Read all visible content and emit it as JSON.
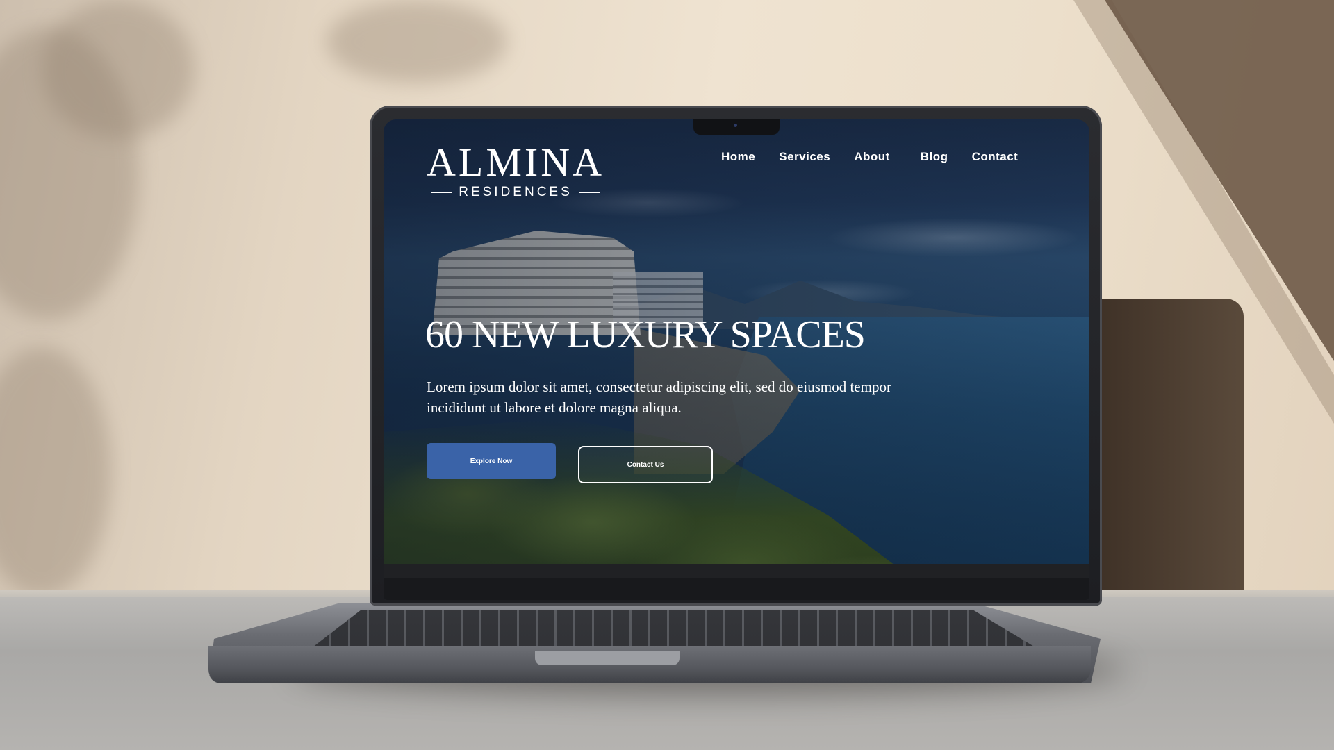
{
  "site": {
    "logo_main": "ALMINA",
    "logo_sub": "RESIDENCES"
  },
  "nav": {
    "items": [
      {
        "label": "Home"
      },
      {
        "label": "Services"
      },
      {
        "label": "About"
      },
      {
        "label": "Blog"
      },
      {
        "label": "Contact"
      }
    ]
  },
  "hero": {
    "title": "60 NEW LUXURY SPACES",
    "body": "Lorem ipsum dolor sit amet, consectetur adipiscing elit, sed do eiusmod tempor incididunt ut labore et dolore magna aliqua.",
    "primary_button": "Explore Now",
    "secondary_button": "Contact Us"
  },
  "colors": {
    "primary_button": "#3a63a8",
    "text": "#ffffff",
    "overlay": "#0c1628"
  }
}
